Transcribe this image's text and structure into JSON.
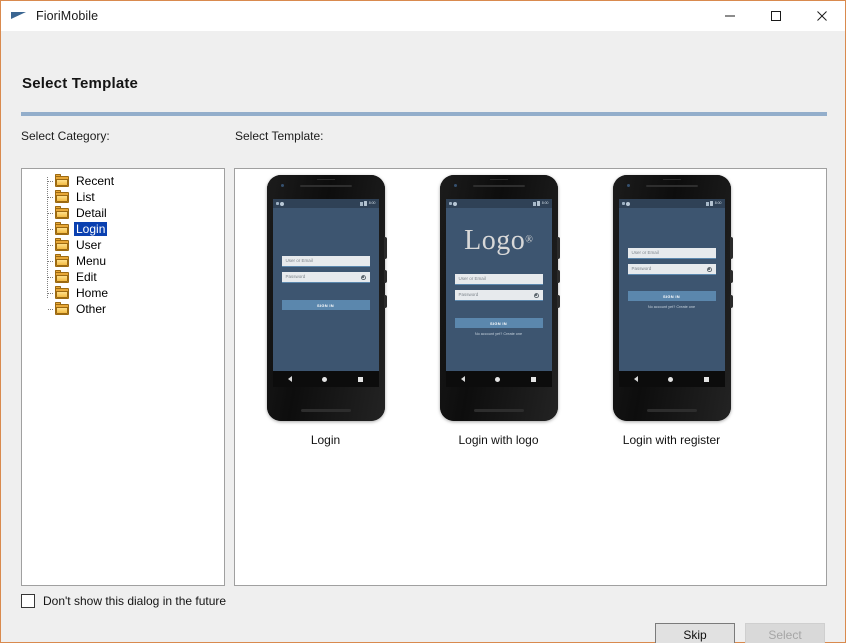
{
  "window": {
    "title": "FioriMobile",
    "icon": "flag-icon",
    "controls": {
      "minimize": "minimize-icon",
      "maximize": "maximize-icon",
      "close": "close-icon"
    }
  },
  "dialog": {
    "heading": "Select Template",
    "category_label": "Select Category:",
    "template_label": "Select Template:"
  },
  "categories": {
    "selected": "Login",
    "items": [
      {
        "label": "Recent",
        "selected": false
      },
      {
        "label": "List",
        "selected": false
      },
      {
        "label": "Detail",
        "selected": false
      },
      {
        "label": "Login",
        "selected": true
      },
      {
        "label": "User",
        "selected": false
      },
      {
        "label": "Menu",
        "selected": false
      },
      {
        "label": "Edit",
        "selected": false
      },
      {
        "label": "Home",
        "selected": false
      },
      {
        "label": "Other",
        "selected": false
      }
    ]
  },
  "templates": [
    {
      "caption": "Login",
      "variant": "plain",
      "logo": "",
      "logo_mark": "",
      "user_field_placeholder": "User or Email",
      "password_field_placeholder": "Password",
      "signin_label": "SIGN IN",
      "register_text": "",
      "status_time": "8:00"
    },
    {
      "caption": "Login with logo",
      "variant": "logo",
      "logo": "Logo",
      "logo_mark": "®",
      "user_field_placeholder": "User or Email",
      "password_field_placeholder": "Password",
      "signin_label": "SIGN IN",
      "register_text": "No account yet? Create one",
      "status_time": "8:00"
    },
    {
      "caption": "Login with register",
      "variant": "register",
      "logo": "",
      "logo_mark": "",
      "user_field_placeholder": "User or Email",
      "password_field_placeholder": "Password",
      "signin_label": "SIGN IN",
      "register_text": "No account yet? Create one",
      "status_time": "8:00"
    }
  ],
  "footer": {
    "dont_show_label": "Don't show this dialog in the future",
    "dont_show_checked": false,
    "skip_label": "Skip",
    "select_label": "Select",
    "select_enabled": false
  },
  "colors": {
    "window_border": "#d98a4e",
    "dialog_bg": "#efefef",
    "rule": "#93aecb",
    "selection": "#0a40b0",
    "phone_screen": "#3d5570",
    "phone_statusbar": "#2f4156",
    "accent_button": "#5b87ad",
    "folder": "#e8a838"
  }
}
